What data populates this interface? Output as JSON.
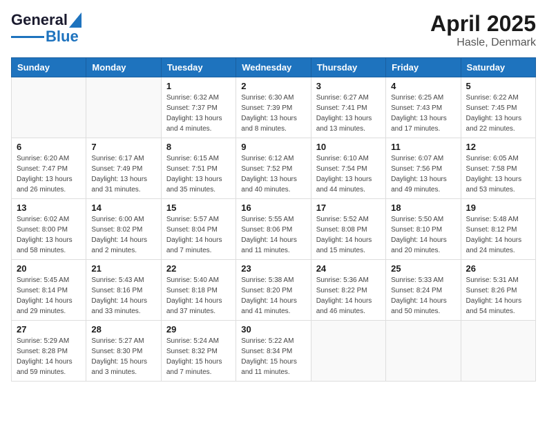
{
  "header": {
    "logo_text_general": "General",
    "logo_text_blue": "Blue",
    "month_year": "April 2025",
    "location": "Hasle, Denmark"
  },
  "weekdays": [
    "Sunday",
    "Monday",
    "Tuesday",
    "Wednesday",
    "Thursday",
    "Friday",
    "Saturday"
  ],
  "weeks": [
    [
      {
        "day": "",
        "sunrise": "",
        "sunset": "",
        "daylight": ""
      },
      {
        "day": "",
        "sunrise": "",
        "sunset": "",
        "daylight": ""
      },
      {
        "day": "1",
        "sunrise": "Sunrise: 6:32 AM",
        "sunset": "Sunset: 7:37 PM",
        "daylight": "Daylight: 13 hours and 4 minutes."
      },
      {
        "day": "2",
        "sunrise": "Sunrise: 6:30 AM",
        "sunset": "Sunset: 7:39 PM",
        "daylight": "Daylight: 13 hours and 8 minutes."
      },
      {
        "day": "3",
        "sunrise": "Sunrise: 6:27 AM",
        "sunset": "Sunset: 7:41 PM",
        "daylight": "Daylight: 13 hours and 13 minutes."
      },
      {
        "day": "4",
        "sunrise": "Sunrise: 6:25 AM",
        "sunset": "Sunset: 7:43 PM",
        "daylight": "Daylight: 13 hours and 17 minutes."
      },
      {
        "day": "5",
        "sunrise": "Sunrise: 6:22 AM",
        "sunset": "Sunset: 7:45 PM",
        "daylight": "Daylight: 13 hours and 22 minutes."
      }
    ],
    [
      {
        "day": "6",
        "sunrise": "Sunrise: 6:20 AM",
        "sunset": "Sunset: 7:47 PM",
        "daylight": "Daylight: 13 hours and 26 minutes."
      },
      {
        "day": "7",
        "sunrise": "Sunrise: 6:17 AM",
        "sunset": "Sunset: 7:49 PM",
        "daylight": "Daylight: 13 hours and 31 minutes."
      },
      {
        "day": "8",
        "sunrise": "Sunrise: 6:15 AM",
        "sunset": "Sunset: 7:51 PM",
        "daylight": "Daylight: 13 hours and 35 minutes."
      },
      {
        "day": "9",
        "sunrise": "Sunrise: 6:12 AM",
        "sunset": "Sunset: 7:52 PM",
        "daylight": "Daylight: 13 hours and 40 minutes."
      },
      {
        "day": "10",
        "sunrise": "Sunrise: 6:10 AM",
        "sunset": "Sunset: 7:54 PM",
        "daylight": "Daylight: 13 hours and 44 minutes."
      },
      {
        "day": "11",
        "sunrise": "Sunrise: 6:07 AM",
        "sunset": "Sunset: 7:56 PM",
        "daylight": "Daylight: 13 hours and 49 minutes."
      },
      {
        "day": "12",
        "sunrise": "Sunrise: 6:05 AM",
        "sunset": "Sunset: 7:58 PM",
        "daylight": "Daylight: 13 hours and 53 minutes."
      }
    ],
    [
      {
        "day": "13",
        "sunrise": "Sunrise: 6:02 AM",
        "sunset": "Sunset: 8:00 PM",
        "daylight": "Daylight: 13 hours and 58 minutes."
      },
      {
        "day": "14",
        "sunrise": "Sunrise: 6:00 AM",
        "sunset": "Sunset: 8:02 PM",
        "daylight": "Daylight: 14 hours and 2 minutes."
      },
      {
        "day": "15",
        "sunrise": "Sunrise: 5:57 AM",
        "sunset": "Sunset: 8:04 PM",
        "daylight": "Daylight: 14 hours and 7 minutes."
      },
      {
        "day": "16",
        "sunrise": "Sunrise: 5:55 AM",
        "sunset": "Sunset: 8:06 PM",
        "daylight": "Daylight: 14 hours and 11 minutes."
      },
      {
        "day": "17",
        "sunrise": "Sunrise: 5:52 AM",
        "sunset": "Sunset: 8:08 PM",
        "daylight": "Daylight: 14 hours and 15 minutes."
      },
      {
        "day": "18",
        "sunrise": "Sunrise: 5:50 AM",
        "sunset": "Sunset: 8:10 PM",
        "daylight": "Daylight: 14 hours and 20 minutes."
      },
      {
        "day": "19",
        "sunrise": "Sunrise: 5:48 AM",
        "sunset": "Sunset: 8:12 PM",
        "daylight": "Daylight: 14 hours and 24 minutes."
      }
    ],
    [
      {
        "day": "20",
        "sunrise": "Sunrise: 5:45 AM",
        "sunset": "Sunset: 8:14 PM",
        "daylight": "Daylight: 14 hours and 29 minutes."
      },
      {
        "day": "21",
        "sunrise": "Sunrise: 5:43 AM",
        "sunset": "Sunset: 8:16 PM",
        "daylight": "Daylight: 14 hours and 33 minutes."
      },
      {
        "day": "22",
        "sunrise": "Sunrise: 5:40 AM",
        "sunset": "Sunset: 8:18 PM",
        "daylight": "Daylight: 14 hours and 37 minutes."
      },
      {
        "day": "23",
        "sunrise": "Sunrise: 5:38 AM",
        "sunset": "Sunset: 8:20 PM",
        "daylight": "Daylight: 14 hours and 41 minutes."
      },
      {
        "day": "24",
        "sunrise": "Sunrise: 5:36 AM",
        "sunset": "Sunset: 8:22 PM",
        "daylight": "Daylight: 14 hours and 46 minutes."
      },
      {
        "day": "25",
        "sunrise": "Sunrise: 5:33 AM",
        "sunset": "Sunset: 8:24 PM",
        "daylight": "Daylight: 14 hours and 50 minutes."
      },
      {
        "day": "26",
        "sunrise": "Sunrise: 5:31 AM",
        "sunset": "Sunset: 8:26 PM",
        "daylight": "Daylight: 14 hours and 54 minutes."
      }
    ],
    [
      {
        "day": "27",
        "sunrise": "Sunrise: 5:29 AM",
        "sunset": "Sunset: 8:28 PM",
        "daylight": "Daylight: 14 hours and 59 minutes."
      },
      {
        "day": "28",
        "sunrise": "Sunrise: 5:27 AM",
        "sunset": "Sunset: 8:30 PM",
        "daylight": "Daylight: 15 hours and 3 minutes."
      },
      {
        "day": "29",
        "sunrise": "Sunrise: 5:24 AM",
        "sunset": "Sunset: 8:32 PM",
        "daylight": "Daylight: 15 hours and 7 minutes."
      },
      {
        "day": "30",
        "sunrise": "Sunrise: 5:22 AM",
        "sunset": "Sunset: 8:34 PM",
        "daylight": "Daylight: 15 hours and 11 minutes."
      },
      {
        "day": "",
        "sunrise": "",
        "sunset": "",
        "daylight": ""
      },
      {
        "day": "",
        "sunrise": "",
        "sunset": "",
        "daylight": ""
      },
      {
        "day": "",
        "sunrise": "",
        "sunset": "",
        "daylight": ""
      }
    ]
  ]
}
